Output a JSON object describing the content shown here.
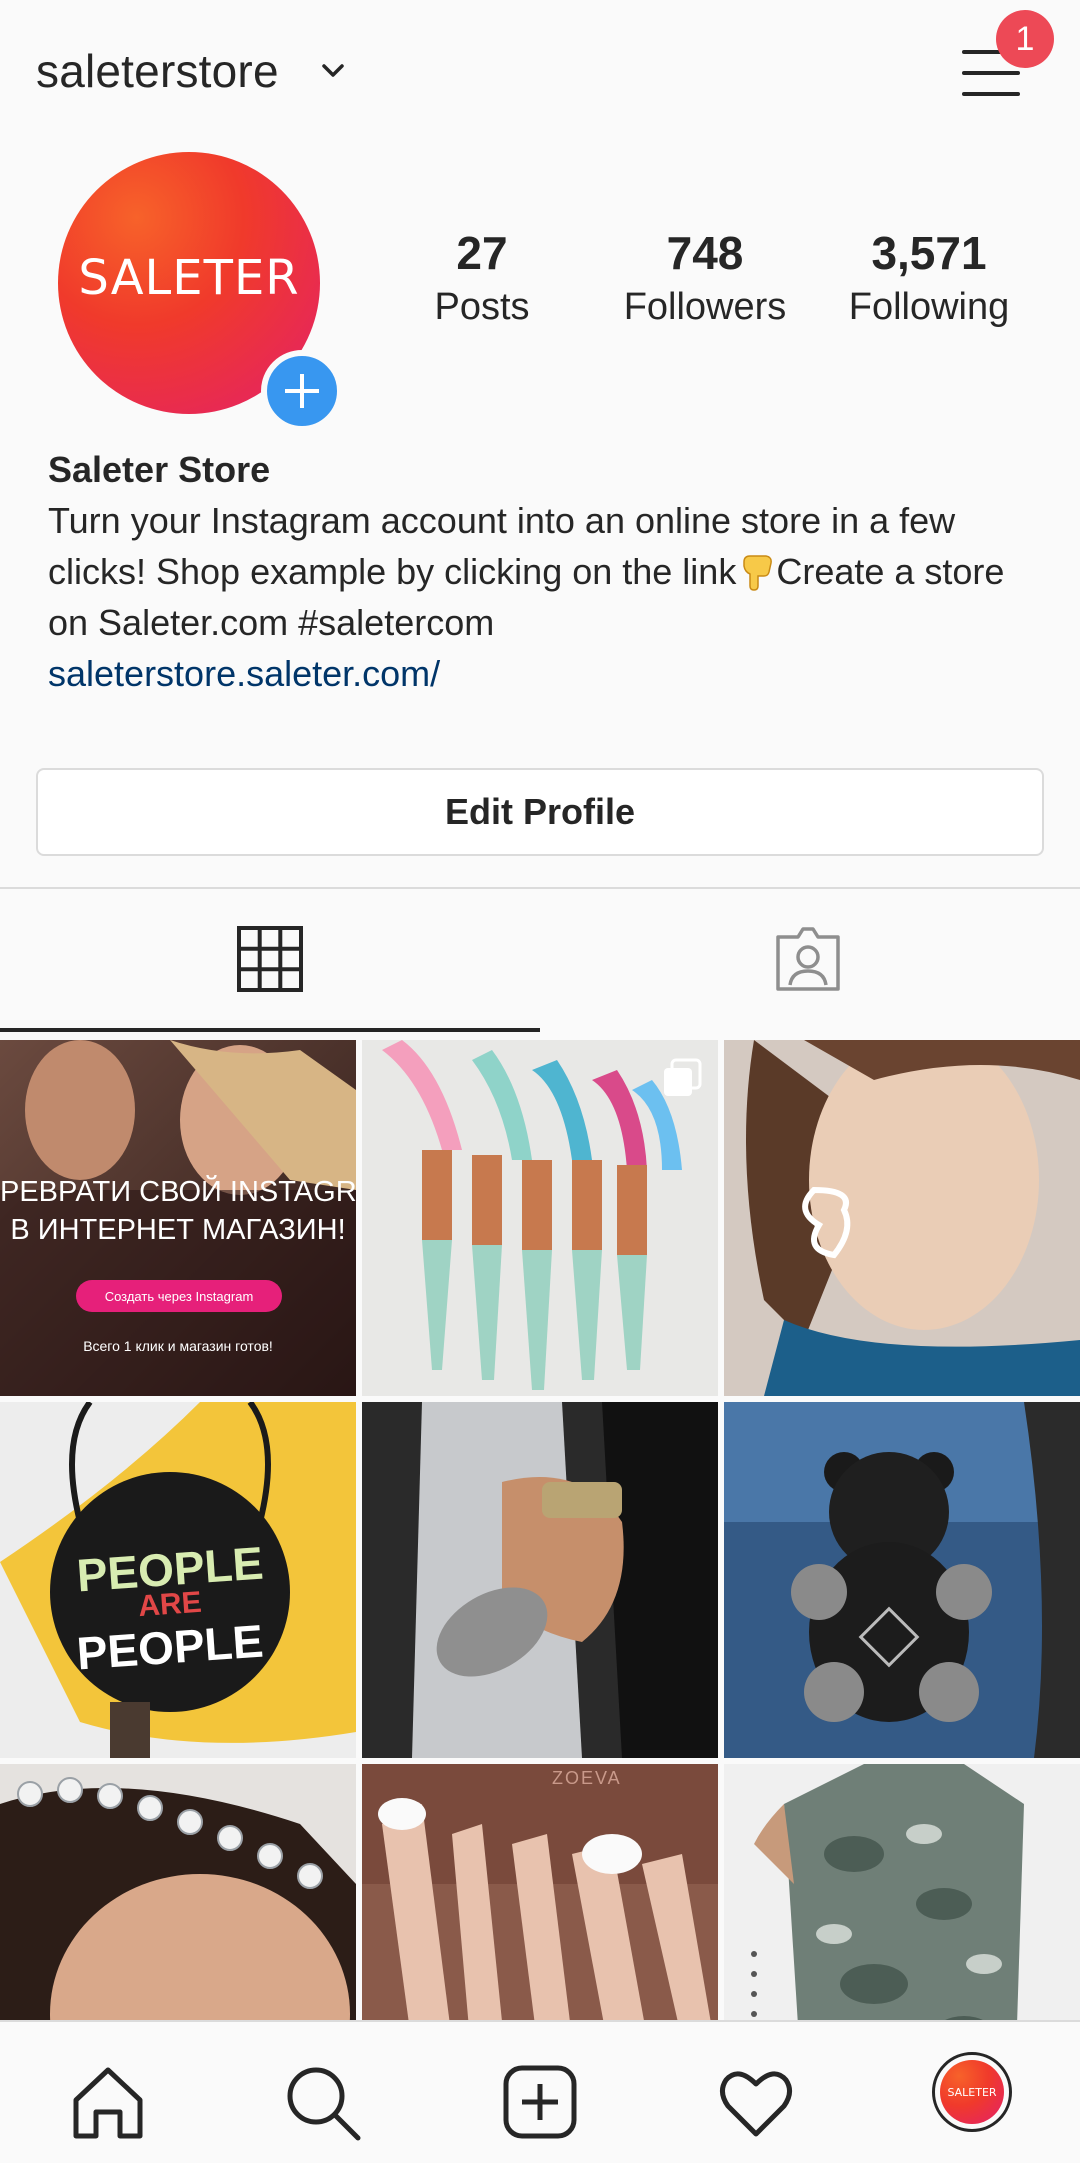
{
  "header": {
    "username": "saleterstore",
    "notification_count": "1"
  },
  "profile": {
    "avatar_text": "SALETER",
    "stats": [
      {
        "value": "27",
        "label": "Posts"
      },
      {
        "value": "748",
        "label": "Followers"
      },
      {
        "value": "3,571",
        "label": "Following"
      }
    ],
    "name": "Saleter Store",
    "bio_line_1": "Turn your Instagram account into an online store in a few clicks! Shop example by clicking on the link",
    "bio_line_2": "Create a store on Saleter.com #saletercom",
    "link": "saleterstore.saleter.com/",
    "edit_button": "Edit Profile"
  },
  "tabs": [
    {
      "name": "grid",
      "icon": "grid-icon",
      "active": true
    },
    {
      "name": "tagged",
      "icon": "tagged-person-icon",
      "active": false
    }
  ],
  "posts": [
    {
      "id": "post-1",
      "overlay_text_1": "РЕВРАТИ СВОЙ INSTAGRA",
      "overlay_text_2": "В ИНТЕРНЕТ МАГАЗИН!",
      "button_text": "Создать через Instagram",
      "caption": "Всего 1 клик и магазин готов!"
    },
    {
      "id": "post-2",
      "multi": true
    },
    {
      "id": "post-3"
    },
    {
      "id": "post-4",
      "bag_text_1": "PEOPLE",
      "bag_text_2": "ARE",
      "bag_text_3": "PEOPLE"
    },
    {
      "id": "post-5"
    },
    {
      "id": "post-6"
    },
    {
      "id": "post-7"
    },
    {
      "id": "post-8",
      "brand": "ZOEVA"
    },
    {
      "id": "post-9"
    }
  ],
  "bottom_nav": {
    "items": [
      "home-icon",
      "search-icon",
      "add-post-icon",
      "heart-icon"
    ],
    "profile_avatar_text": "SALETER"
  }
}
